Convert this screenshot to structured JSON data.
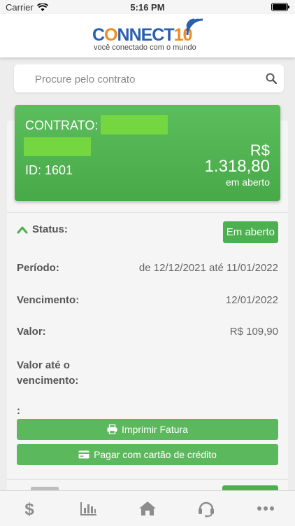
{
  "status_bar": {
    "carrier": "Carrier",
    "time": "5:16 PM"
  },
  "header": {
    "logo_text_a": "C",
    "logo_text_o": "O",
    "logo_text_b": "NNECT",
    "logo_text_num": "10",
    "logo_subtitle": "você conectado com o mundo"
  },
  "search": {
    "placeholder": "Procure pelo contrato"
  },
  "contract": {
    "label": "CONTRATO:",
    "id_label": "ID: 1601",
    "currency": "R$",
    "amount": "1.318,80",
    "status": "em aberto"
  },
  "invoice": {
    "status_label": "Status:",
    "status_badge": "Em aberto",
    "period_label": "Período:",
    "period_value": "de 12/12/2021 até 11/01/2022",
    "due_label": "Vencimento:",
    "due_value": "12/01/2022",
    "value_label": "Valor:",
    "value_value": "R$ 109,90",
    "value_until_label_1": "Valor até o",
    "value_until_label_2": "vencimento:",
    "colon": ":",
    "print_button": "Imprimir Fatura",
    "pay_button": "Pagar com cartão de crédito"
  },
  "tabbar": {
    "items": [
      {
        "icon": "dollar-icon"
      },
      {
        "icon": "chart-icon"
      },
      {
        "icon": "home-icon"
      },
      {
        "icon": "headset-icon"
      },
      {
        "icon": "more-icon"
      }
    ]
  },
  "colors": {
    "accent": "#4caf50",
    "brand_blue": "#2a5fb0",
    "brand_orange": "#f28c1b"
  }
}
